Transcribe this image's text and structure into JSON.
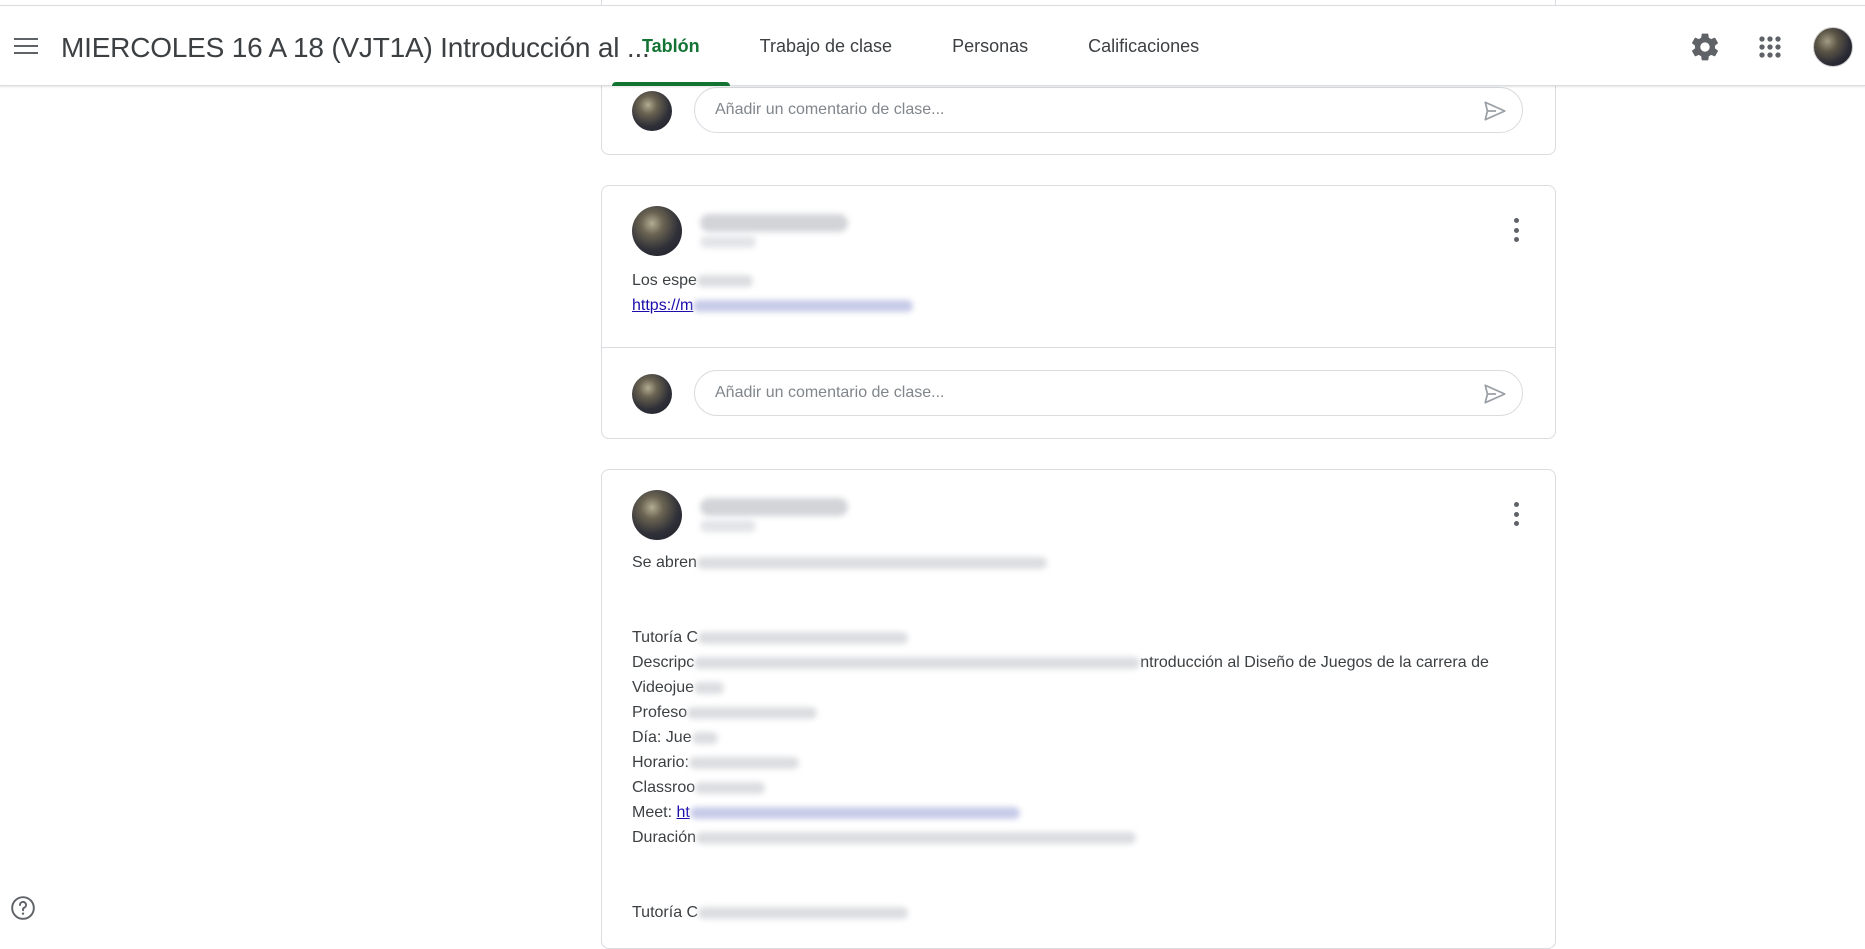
{
  "header": {
    "menu_icon": "hamburger-menu-icon",
    "class_title": "MIERCOLES 16 A 18 (VJT1A) Introducción al ...",
    "tabs": [
      {
        "label": "Tablón",
        "active": true
      },
      {
        "label": "Trabajo de clase",
        "active": false
      },
      {
        "label": "Personas",
        "active": false
      },
      {
        "label": "Calificaciones",
        "active": false
      }
    ],
    "settings_icon": "gear-icon",
    "apps_icon": "apps-grid-icon",
    "accent_color": "#137333"
  },
  "feed": {
    "comment_placeholder": "Añadir un comentario de clase...",
    "posts": [
      {
        "lines": [
          "Los espe",
          "https://m"
        ]
      },
      {
        "lines": [
          "Se abren",
          "Tutoría C",
          "Descripc",
          "ntroducción al Diseño de Juegos de la carrera de",
          "Videojue",
          "Profeso",
          "Día: Jue",
          "Horario:",
          "Classroo",
          "Meet: ",
          "ht",
          "Duración",
          "Tutoría C"
        ]
      }
    ]
  },
  "footer": {
    "help_icon": "help-circle-icon"
  }
}
